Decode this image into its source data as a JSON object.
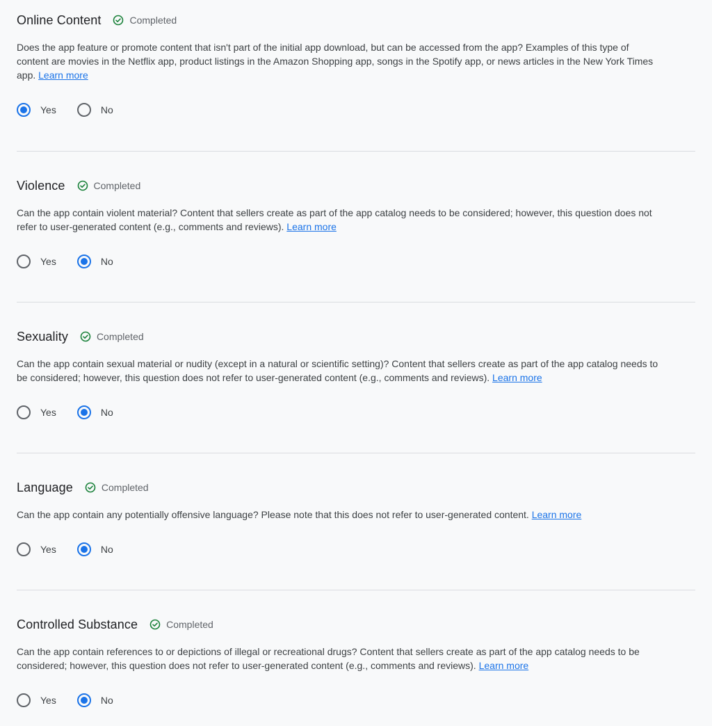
{
  "colors": {
    "accent": "#1a73e8",
    "completed_green": "#188038",
    "divider": "#dadce0",
    "background": "#f8f9fa"
  },
  "sections": [
    {
      "title": "Online Content",
      "status": "Completed",
      "status_icon": "check-circle-icon",
      "description": "Does the app feature or promote content that isn't part of the initial app download, but can be accessed from the app? Examples of this type of content are movies in the Netflix app, product listings in the Amazon Shopping app, songs in the Spotify app, or news articles in the New York Times app.",
      "learn_more": "Learn more",
      "options": {
        "yes": "Yes",
        "no": "No"
      },
      "selected": "yes"
    },
    {
      "title": "Violence",
      "status": "Completed",
      "status_icon": "check-circle-icon",
      "description": "Can the app contain violent material? Content that sellers create as part of the app catalog needs to be considered; however, this question does not refer to user-generated content (e.g., comments and reviews).",
      "learn_more": "Learn more",
      "options": {
        "yes": "Yes",
        "no": "No"
      },
      "selected": "no"
    },
    {
      "title": "Sexuality",
      "status": "Completed",
      "status_icon": "check-circle-icon",
      "description": "Can the app contain sexual material or nudity (except in a natural or scientific setting)? Content that sellers create as part of the app catalog needs to be considered; however, this question does not refer to user-generated content (e.g., comments and reviews).",
      "learn_more": "Learn more",
      "options": {
        "yes": "Yes",
        "no": "No"
      },
      "selected": "no"
    },
    {
      "title": "Language",
      "status": "Completed",
      "status_icon": "check-circle-icon",
      "description": "Can the app contain any potentially offensive language? Please note that this does not refer to user-generated content.",
      "learn_more": "Learn more",
      "options": {
        "yes": "Yes",
        "no": "No"
      },
      "selected": "no"
    },
    {
      "title": "Controlled Substance",
      "status": "Completed",
      "status_icon": "check-circle-icon",
      "description": "Can the app contain references to or depictions of illegal or recreational drugs? Content that sellers create as part of the app catalog needs to be considered; however, this question does not refer to user-generated content (e.g., comments and reviews).",
      "learn_more": "Learn more",
      "options": {
        "yes": "Yes",
        "no": "No"
      },
      "selected": "no"
    }
  ]
}
